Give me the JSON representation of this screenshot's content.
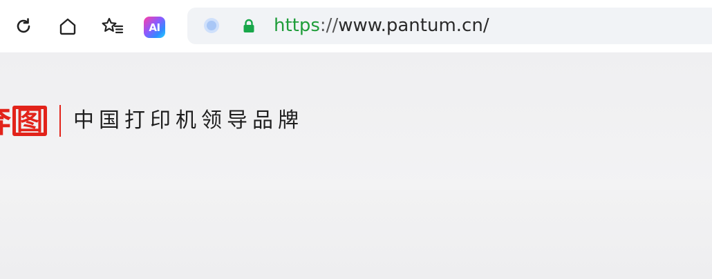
{
  "toolbar": {
    "reload_icon": "reload-icon",
    "home_icon": "home-icon",
    "favorites_icon": "favorites-star-list-icon",
    "ai_badge_label": "AI"
  },
  "address_bar": {
    "site_icon": "site-info-icon",
    "lock_icon": "lock-icon",
    "url_scheme": "https",
    "url_separator": "://",
    "url_rest": "www.pantum.cn/"
  },
  "site": {
    "brand_partial": "奔图",
    "brand_char_1": "奔",
    "brand_char_2": "图",
    "slogan": "中国打印机领导品牌",
    "brand_color": "#e2231a"
  },
  "colors": {
    "secure_scheme": "#1f9d3a",
    "lock": "#18a74a",
    "page_background": "#f2f2f3"
  }
}
